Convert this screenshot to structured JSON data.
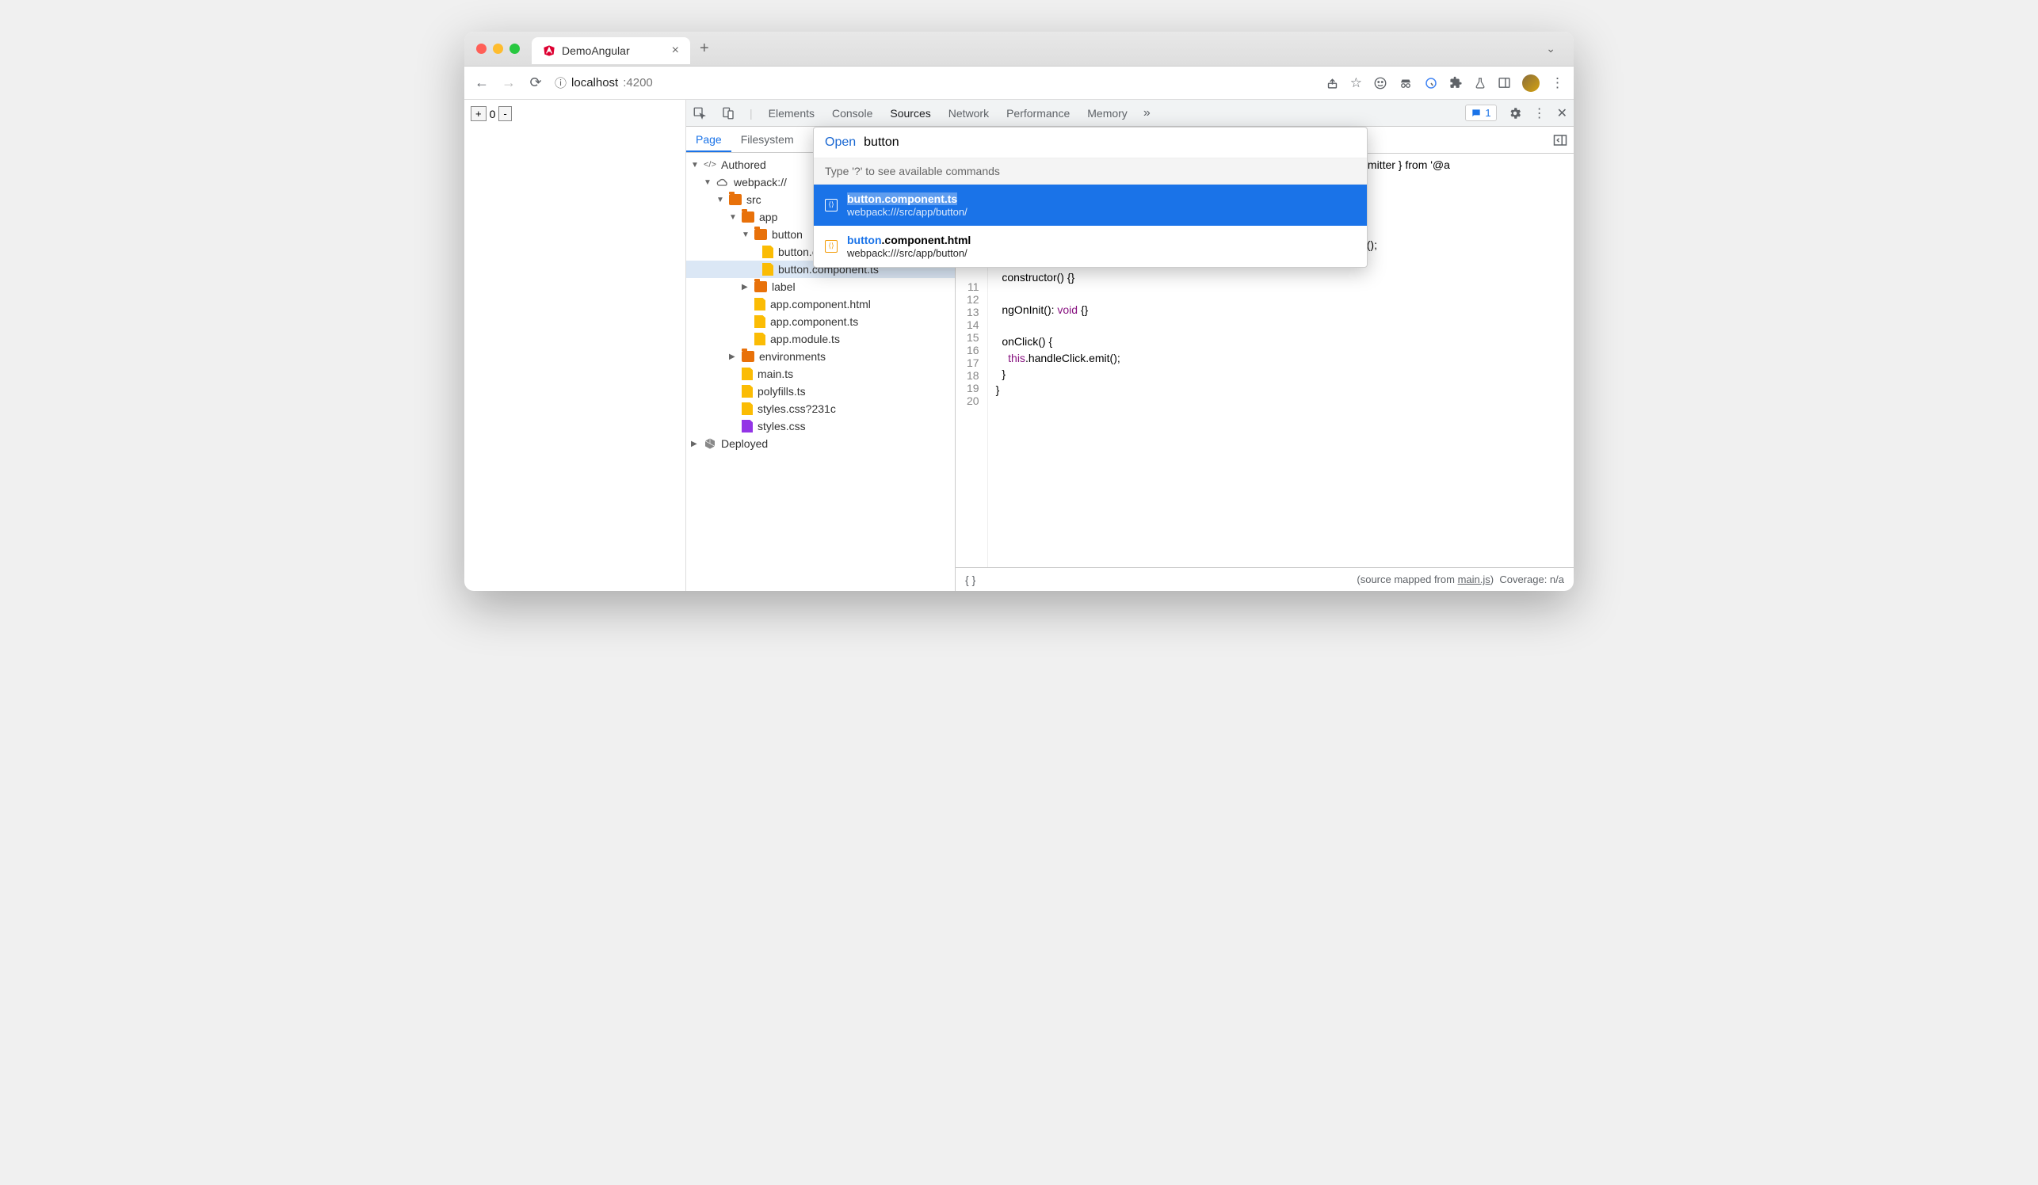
{
  "tab": {
    "title": "DemoAngular"
  },
  "url": {
    "host": "localhost",
    "port": ":4200"
  },
  "page_controls": {
    "plus": "+",
    "zero": "0",
    "minus": "-"
  },
  "devtools_tabs": [
    "Elements",
    "Console",
    "Sources",
    "Network",
    "Performance",
    "Memory"
  ],
  "devtools_active": "Sources",
  "issue_count": "1",
  "sources_tabs": [
    "Page",
    "Filesystem"
  ],
  "sources_tabs_active": "Page",
  "tree": {
    "authored": "Authored",
    "webpack": "webpack://",
    "src": "src",
    "app": "app",
    "button_folder": "button",
    "button_html": "button.component.html",
    "button_ts": "button.component.ts",
    "label": "label",
    "app_html": "app.component.html",
    "app_ts": "app.component.ts",
    "app_module": "app.module.ts",
    "environments": "environments",
    "main_ts": "main.ts",
    "polyfills": "polyfills.ts",
    "styles_q": "styles.css?231c",
    "styles": "styles.css",
    "deployed": "Deployed"
  },
  "palette": {
    "open_label": "Open",
    "query": "button",
    "hint": "Type '?' to see available commands",
    "results": [
      {
        "title": "button.component.ts",
        "path": "webpack:///src/app/button/",
        "match": "button"
      },
      {
        "title": "button.component.html",
        "path": "webpack:///src/app/button/",
        "match": "button"
      }
    ]
  },
  "editor": {
    "visible_import_tail": "Emitter } from '@a",
    "line10_tail": ">();",
    "l11": "11",
    "l12": "12",
    "l13": "13",
    "l14": "14",
    "l15": "15",
    "l16": "16",
    "l17": "17",
    "l18": "18",
    "l19": "19",
    "l20": "20"
  },
  "status": {
    "mapped_prefix": "(source mapped from ",
    "mapped_file": "main.js",
    "mapped_suffix": ")",
    "coverage": "Coverage: n/a"
  }
}
